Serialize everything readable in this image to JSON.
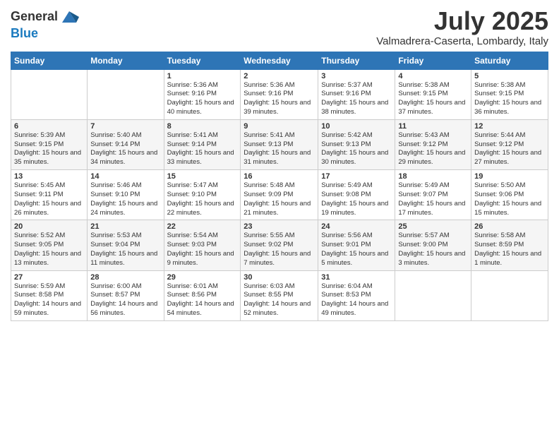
{
  "logo": {
    "general": "General",
    "blue": "Blue"
  },
  "header": {
    "month": "July 2025",
    "location": "Valmadrera-Caserta, Lombardy, Italy"
  },
  "weekdays": [
    "Sunday",
    "Monday",
    "Tuesday",
    "Wednesday",
    "Thursday",
    "Friday",
    "Saturday"
  ],
  "weeks": [
    [
      {
        "day": "",
        "info": ""
      },
      {
        "day": "",
        "info": ""
      },
      {
        "day": "1",
        "info": "Sunrise: 5:36 AM\nSunset: 9:16 PM\nDaylight: 15 hours and 40 minutes."
      },
      {
        "day": "2",
        "info": "Sunrise: 5:36 AM\nSunset: 9:16 PM\nDaylight: 15 hours and 39 minutes."
      },
      {
        "day": "3",
        "info": "Sunrise: 5:37 AM\nSunset: 9:16 PM\nDaylight: 15 hours and 38 minutes."
      },
      {
        "day": "4",
        "info": "Sunrise: 5:38 AM\nSunset: 9:15 PM\nDaylight: 15 hours and 37 minutes."
      },
      {
        "day": "5",
        "info": "Sunrise: 5:38 AM\nSunset: 9:15 PM\nDaylight: 15 hours and 36 minutes."
      }
    ],
    [
      {
        "day": "6",
        "info": "Sunrise: 5:39 AM\nSunset: 9:15 PM\nDaylight: 15 hours and 35 minutes."
      },
      {
        "day": "7",
        "info": "Sunrise: 5:40 AM\nSunset: 9:14 PM\nDaylight: 15 hours and 34 minutes."
      },
      {
        "day": "8",
        "info": "Sunrise: 5:41 AM\nSunset: 9:14 PM\nDaylight: 15 hours and 33 minutes."
      },
      {
        "day": "9",
        "info": "Sunrise: 5:41 AM\nSunset: 9:13 PM\nDaylight: 15 hours and 31 minutes."
      },
      {
        "day": "10",
        "info": "Sunrise: 5:42 AM\nSunset: 9:13 PM\nDaylight: 15 hours and 30 minutes."
      },
      {
        "day": "11",
        "info": "Sunrise: 5:43 AM\nSunset: 9:12 PM\nDaylight: 15 hours and 29 minutes."
      },
      {
        "day": "12",
        "info": "Sunrise: 5:44 AM\nSunset: 9:12 PM\nDaylight: 15 hours and 27 minutes."
      }
    ],
    [
      {
        "day": "13",
        "info": "Sunrise: 5:45 AM\nSunset: 9:11 PM\nDaylight: 15 hours and 26 minutes."
      },
      {
        "day": "14",
        "info": "Sunrise: 5:46 AM\nSunset: 9:10 PM\nDaylight: 15 hours and 24 minutes."
      },
      {
        "day": "15",
        "info": "Sunrise: 5:47 AM\nSunset: 9:10 PM\nDaylight: 15 hours and 22 minutes."
      },
      {
        "day": "16",
        "info": "Sunrise: 5:48 AM\nSunset: 9:09 PM\nDaylight: 15 hours and 21 minutes."
      },
      {
        "day": "17",
        "info": "Sunrise: 5:49 AM\nSunset: 9:08 PM\nDaylight: 15 hours and 19 minutes."
      },
      {
        "day": "18",
        "info": "Sunrise: 5:49 AM\nSunset: 9:07 PM\nDaylight: 15 hours and 17 minutes."
      },
      {
        "day": "19",
        "info": "Sunrise: 5:50 AM\nSunset: 9:06 PM\nDaylight: 15 hours and 15 minutes."
      }
    ],
    [
      {
        "day": "20",
        "info": "Sunrise: 5:52 AM\nSunset: 9:05 PM\nDaylight: 15 hours and 13 minutes."
      },
      {
        "day": "21",
        "info": "Sunrise: 5:53 AM\nSunset: 9:04 PM\nDaylight: 15 hours and 11 minutes."
      },
      {
        "day": "22",
        "info": "Sunrise: 5:54 AM\nSunset: 9:03 PM\nDaylight: 15 hours and 9 minutes."
      },
      {
        "day": "23",
        "info": "Sunrise: 5:55 AM\nSunset: 9:02 PM\nDaylight: 15 hours and 7 minutes."
      },
      {
        "day": "24",
        "info": "Sunrise: 5:56 AM\nSunset: 9:01 PM\nDaylight: 15 hours and 5 minutes."
      },
      {
        "day": "25",
        "info": "Sunrise: 5:57 AM\nSunset: 9:00 PM\nDaylight: 15 hours and 3 minutes."
      },
      {
        "day": "26",
        "info": "Sunrise: 5:58 AM\nSunset: 8:59 PM\nDaylight: 15 hours and 1 minute."
      }
    ],
    [
      {
        "day": "27",
        "info": "Sunrise: 5:59 AM\nSunset: 8:58 PM\nDaylight: 14 hours and 59 minutes."
      },
      {
        "day": "28",
        "info": "Sunrise: 6:00 AM\nSunset: 8:57 PM\nDaylight: 14 hours and 56 minutes."
      },
      {
        "day": "29",
        "info": "Sunrise: 6:01 AM\nSunset: 8:56 PM\nDaylight: 14 hours and 54 minutes."
      },
      {
        "day": "30",
        "info": "Sunrise: 6:03 AM\nSunset: 8:55 PM\nDaylight: 14 hours and 52 minutes."
      },
      {
        "day": "31",
        "info": "Sunrise: 6:04 AM\nSunset: 8:53 PM\nDaylight: 14 hours and 49 minutes."
      },
      {
        "day": "",
        "info": ""
      },
      {
        "day": "",
        "info": ""
      }
    ]
  ]
}
